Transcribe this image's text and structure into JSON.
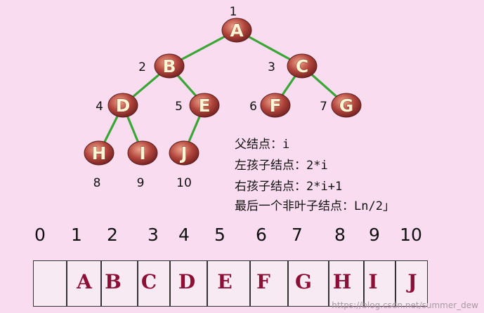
{
  "tree": {
    "nodes": [
      {
        "letter": "A",
        "index": "1"
      },
      {
        "letter": "B",
        "index": "2"
      },
      {
        "letter": "C",
        "index": "3"
      },
      {
        "letter": "D",
        "index": "4"
      },
      {
        "letter": "E",
        "index": "5"
      },
      {
        "letter": "F",
        "index": "6"
      },
      {
        "letter": "G",
        "index": "7"
      },
      {
        "letter": "H",
        "index": "8"
      },
      {
        "letter": "I",
        "index": "9"
      },
      {
        "letter": "J",
        "index": "10"
      }
    ],
    "edges": [
      [
        "A",
        "B"
      ],
      [
        "A",
        "C"
      ],
      [
        "B",
        "D"
      ],
      [
        "B",
        "E"
      ],
      [
        "C",
        "F"
      ],
      [
        "C",
        "G"
      ],
      [
        "D",
        "H"
      ],
      [
        "D",
        "I"
      ],
      [
        "E",
        "J"
      ]
    ],
    "colors": {
      "node_fill": "#a33b3b",
      "edge": "#3aa635"
    }
  },
  "formulas": [
    "父结点：i",
    "左孩子结点：2*i",
    "右孩子结点：2*i+1",
    "最后一个非叶子结点：Ln/2」"
  ],
  "array": {
    "indices": [
      "0",
      "1",
      "2",
      "3",
      "4",
      "5",
      "6",
      "7",
      "8",
      "9",
      "10"
    ],
    "cells": [
      "",
      "A",
      "B",
      "C",
      "D",
      "E",
      "F",
      "G",
      "H",
      "I",
      "J"
    ]
  },
  "watermark": "https://blog.csdn.net/summer_dew"
}
